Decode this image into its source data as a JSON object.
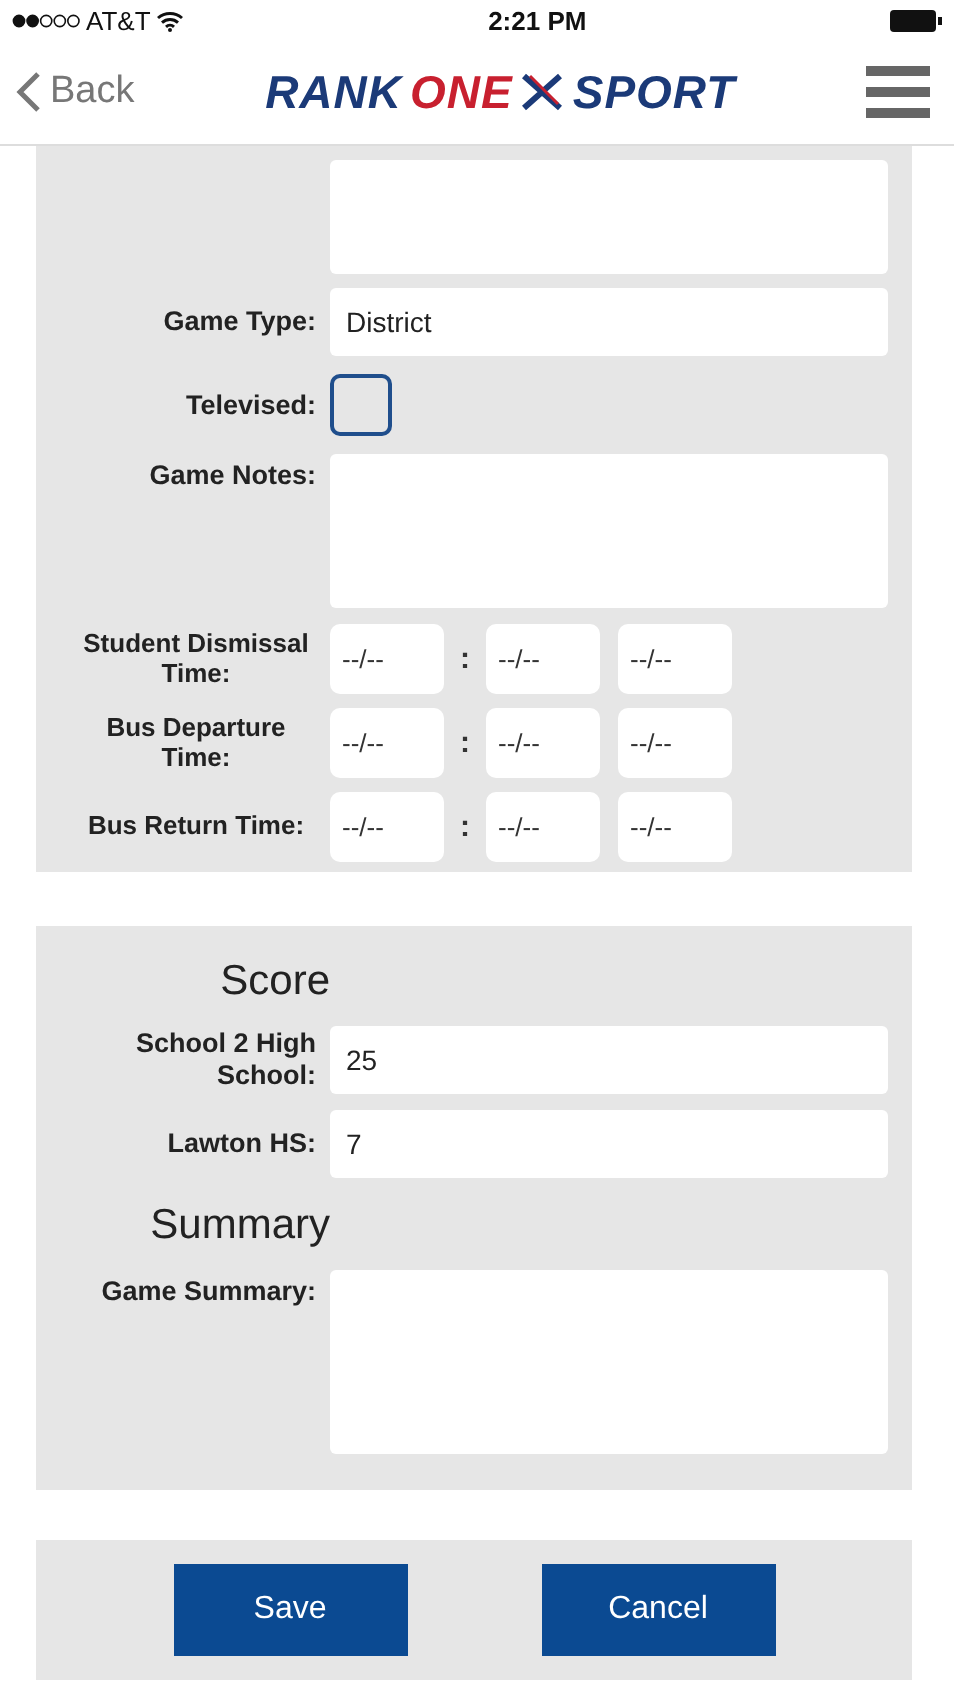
{
  "status_bar": {
    "carrier": "AT&T",
    "time": "2:21 PM"
  },
  "nav": {
    "back": "Back",
    "logo": [
      {
        "text": "RANK",
        "kind": "navy"
      },
      {
        "text": "ONE",
        "kind": "red"
      },
      {
        "text": "SPORT",
        "kind": "navy"
      }
    ]
  },
  "game_panel": {
    "fields": [
      {
        "kind": "textarea"
      },
      {
        "kind": "text",
        "label": "Game Type:",
        "value": "District"
      },
      {
        "kind": "checkbox",
        "label": "Televised:",
        "checked": false
      },
      {
        "kind": "textarea",
        "label": "Game Notes:"
      },
      {
        "kind": "time",
        "label": "Student Dismissal Time:",
        "parts": [
          "--/--",
          "--/--",
          "--/--"
        ],
        "separator": ":"
      },
      {
        "kind": "time",
        "label": "Bus Departure Time:",
        "parts": [
          "--/--",
          "--/--",
          "--/--"
        ],
        "separator": ":"
      },
      {
        "kind": "time",
        "label": "Bus Return Time:",
        "parts": [
          "--/--",
          "--/--",
          "--/--"
        ],
        "separator": ":"
      }
    ]
  },
  "score_panel": {
    "score_heading": "Score",
    "scores": [
      {
        "label": "School 2 High School:",
        "value": "25"
      },
      {
        "label": "Lawton HS:",
        "value": "7"
      }
    ],
    "summary_heading": "Summary",
    "summary_label": "Game Summary:"
  },
  "buttons": [
    "Save",
    "Cancel"
  ]
}
